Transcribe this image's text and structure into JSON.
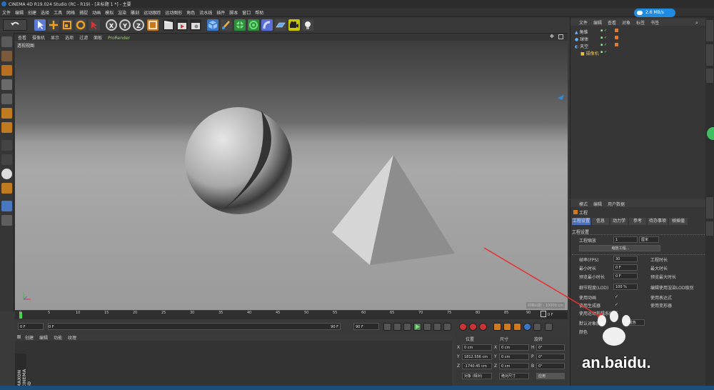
{
  "window": {
    "title": "CINEMA 4D R19.024 Studio (RC - R19) - [未标题 1 *] - 主要"
  },
  "menu": [
    "文件",
    "编辑",
    "创建",
    "选择",
    "工具",
    "网格",
    "捕捉",
    "动画",
    "模拟",
    "渲染",
    "雕刻",
    "运动跟踪",
    "运动图形",
    "角色",
    "流水线",
    "插件",
    "脚本",
    "窗口",
    "帮助"
  ],
  "net_badge": "2.6 MB/s",
  "toolbar": {
    "x_label": "X",
    "y_label": "Y",
    "z_label": "Z"
  },
  "viewport": {
    "menu": [
      "查看",
      "摄像机",
      "显示",
      "选项",
      "过滤",
      "面板",
      "ProRender"
    ],
    "title": "透视视图",
    "grid_label": "网格间距 : 10000 cm"
  },
  "timeline": {
    "ticks": [
      "0",
      "5",
      "10",
      "15",
      "20",
      "25",
      "30",
      "35",
      "40",
      "45",
      "50",
      "55",
      "60",
      "65",
      "70",
      "75",
      "80",
      "85",
      "90"
    ],
    "end_field": "0 F"
  },
  "playbar": {
    "start": "0 F",
    "current": "0 F",
    "end": "90 F",
    "end2": "90 F"
  },
  "material_panel": {
    "tabs": [
      "创建",
      "编辑",
      "功能",
      "纹理"
    ]
  },
  "coords": {
    "headers": {
      "position": "位置",
      "size": "尺寸",
      "rotation": "旋转"
    },
    "rows": [
      {
        "axis": "X",
        "pos": "0 cm",
        "size_axis": "X",
        "size": "0 cm",
        "rot_axis": "H",
        "rot": "0°"
      },
      {
        "axis": "Y",
        "pos": "1812.556 cm",
        "size_axis": "Y",
        "size": "0 cm",
        "rot_axis": "P",
        "rot": "0°"
      },
      {
        "axis": "Z",
        "pos": "-1740.45 cm",
        "size_axis": "Z",
        "size": "0 cm",
        "rot_axis": "B",
        "rot": "0°"
      }
    ],
    "mode": "对象 (相对)",
    "size_mode": "绝对尺寸",
    "apply": "应用"
  },
  "object_manager": {
    "tabs": [
      "文件",
      "编辑",
      "查看",
      "对象",
      "标签",
      "书签"
    ],
    "items": [
      "角锥",
      "球体",
      "天空",
      "摄像机"
    ]
  },
  "attributes": {
    "tabs": [
      "模式",
      "编辑",
      "用户数据"
    ],
    "title": "工程",
    "subtabs": [
      "工程设置",
      "信息",
      "动力学",
      "参考",
      "待办事项",
      "帧插值"
    ],
    "section": "工程设置",
    "scale_label": "工程缩放",
    "scale_value": "1",
    "scale_unit": "厘米",
    "scale_button": "缩放工程...",
    "rows": [
      {
        "label": "帧率(FPS)",
        "value": "30",
        "right": "工程时长"
      },
      {
        "label": "最小时长",
        "value": "0 F",
        "right": "最大时长"
      },
      {
        "label": "预览最小时长",
        "value": "0 F",
        "right": "预览最大时长"
      },
      {
        "label": "细节程度(LOD)",
        "value": "100 %",
        "right": "编辑使用渲染LOD级别"
      },
      {
        "label": "使用动画",
        "value": "✓",
        "right": "使用表达式"
      },
      {
        "label": "使用生成器",
        "value": "✓",
        "right": "使用变形器"
      },
      {
        "label": "使用运动剪辑系统",
        "value": "✓",
        "right": ""
      },
      {
        "label": "默认对象颜色",
        "value": "灰蓝色",
        "right": ""
      },
      {
        "label": "颜色",
        "value": "",
        "right": ""
      }
    ]
  },
  "watermark": {
    "text": "an.baidu."
  },
  "colors": {
    "accent": "#2b8de0",
    "background": "#3a3a3a",
    "annotation_arrow": "#e53030"
  }
}
